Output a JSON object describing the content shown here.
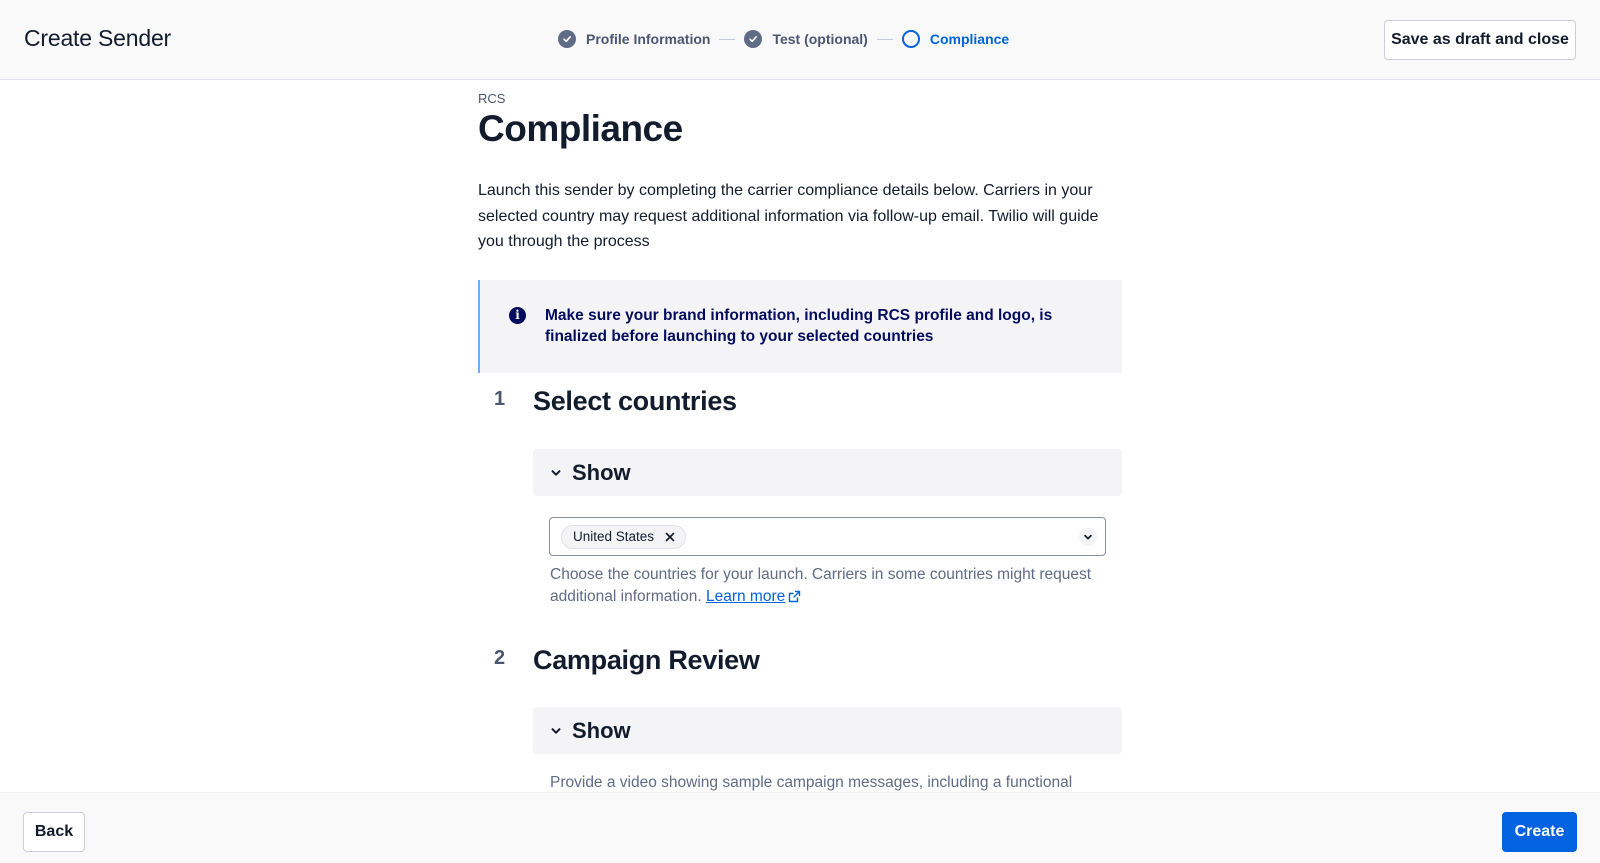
{
  "header": {
    "title": "Create Sender",
    "save_draft_label": "Save as draft and close",
    "steps": [
      {
        "label": "Profile Information",
        "state": "complete"
      },
      {
        "label": "Test (optional)",
        "state": "complete"
      },
      {
        "label": "Compliance",
        "state": "current"
      }
    ]
  },
  "page": {
    "eyebrow": "RCS",
    "title": "Compliance",
    "intro": "Launch this sender by completing the carrier compliance details below. Carriers in your selected country may request additional information via follow-up email. Twilio will guide you through the process"
  },
  "callout": {
    "icon": "info-icon",
    "text": "Make sure your brand information, including RCS profile and logo, is finalized before launching to your selected countries"
  },
  "sections": [
    {
      "number": "1",
      "title": "Select countries",
      "disclosure_label": "Show",
      "selected_countries": [
        "United States"
      ],
      "help_text": "Choose the countries for your launch. Carriers in some countries might request additional information.",
      "help_link": "Learn more"
    },
    {
      "number": "2",
      "title": "Campaign Review",
      "disclosure_label": "Show",
      "help_text": "Provide a video showing sample campaign messages, including a functional"
    }
  ],
  "footer": {
    "back_label": "Back",
    "create_label": "Create"
  },
  "colors": {
    "primary": "#0263e0",
    "callout_text": "#030b5d",
    "callout_border": "#6eaffc",
    "step_complete": "#606b85"
  }
}
